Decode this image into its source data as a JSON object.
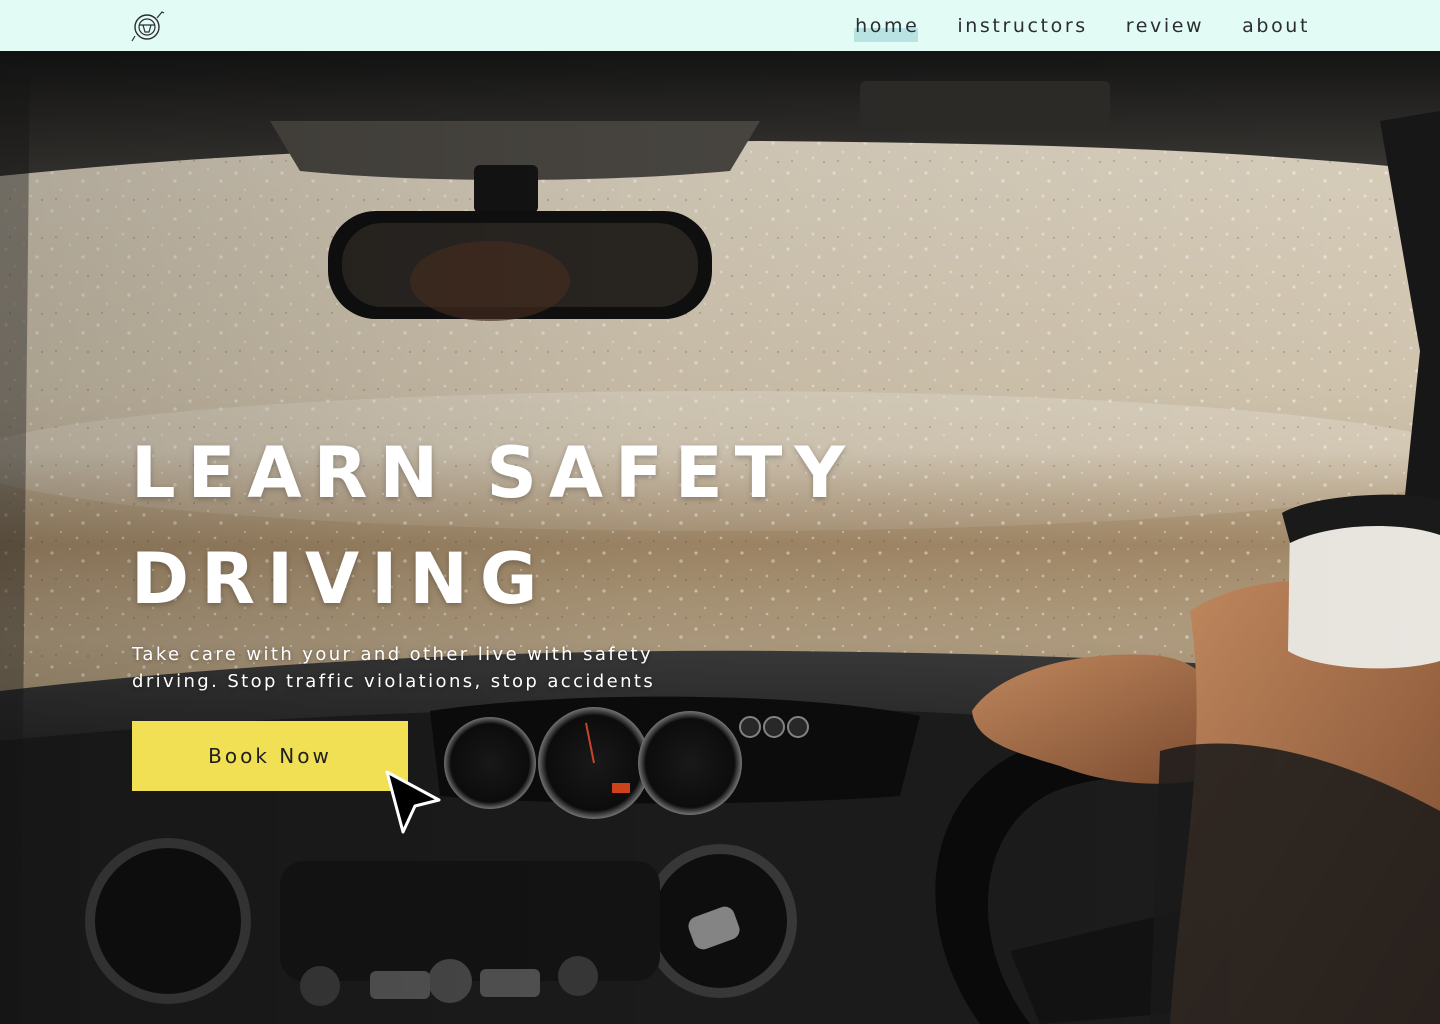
{
  "nav": {
    "logo_icon": "steering-wheel-icon",
    "links": [
      {
        "label": "home",
        "active": true
      },
      {
        "label": "instructors",
        "active": false
      },
      {
        "label": "review",
        "active": false
      },
      {
        "label": "about",
        "active": false
      }
    ]
  },
  "hero": {
    "title_line1": "LEARN SAFETY",
    "title_line2": "DRIVING",
    "subtitle": "Take care with your and other live with safety driving. Stop traffic violations, stop accidents",
    "cta_label": "Book Now",
    "background_icon": "car-interior-windshield-photo"
  },
  "colors": {
    "nav_bg": "#e2fbf5",
    "nav_active_highlight": "#b9e3e2",
    "cta_bg": "#f2e054",
    "hero_text": "#ffffff"
  }
}
